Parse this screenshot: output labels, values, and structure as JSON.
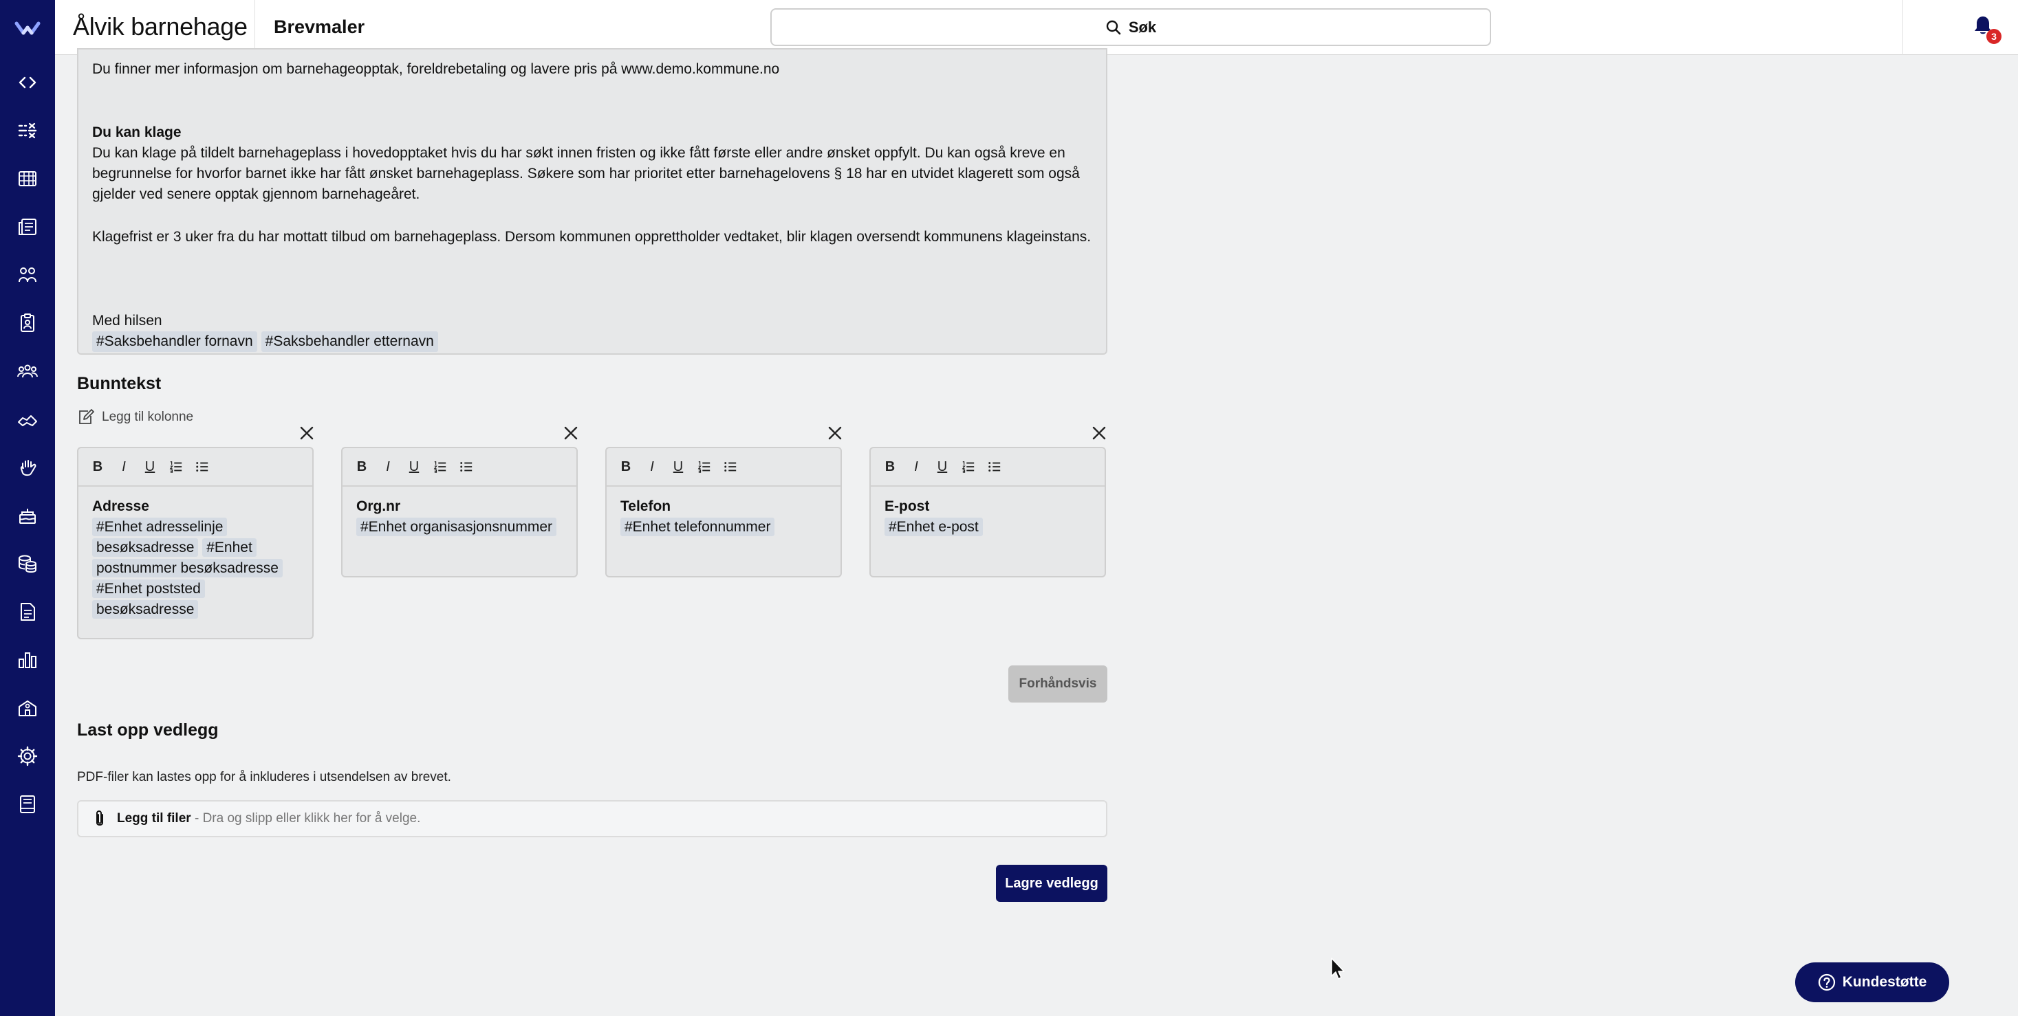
{
  "header": {
    "org_name": "Ålvik barnehage",
    "page_title": "Brevmaler",
    "search_label": "Søk",
    "notification_count": "3"
  },
  "sidebar": {
    "items": [
      {
        "icon": "code-icon"
      },
      {
        "icon": "tasks-icon"
      },
      {
        "icon": "table-icon"
      },
      {
        "icon": "documents-icon"
      },
      {
        "icon": "children-icon"
      },
      {
        "icon": "badge-icon"
      },
      {
        "icon": "group-icon"
      },
      {
        "icon": "handshake-icon"
      },
      {
        "icon": "hand-icon"
      },
      {
        "icon": "cake-icon"
      },
      {
        "icon": "coins-icon"
      },
      {
        "icon": "file-icon"
      },
      {
        "icon": "chart-icon"
      },
      {
        "icon": "school-icon"
      },
      {
        "icon": "settings-icon"
      },
      {
        "icon": "book-icon"
      }
    ]
  },
  "letter": {
    "info_line": "Du finner mer informasjon om barnehageopptak, foreldrebetaling og lavere pris på www.demo.kommune.no",
    "complaint_heading": "Du kan klage",
    "complaint_p1": "Du kan klage på tildelt barnehageplass i hovedopptaket hvis du har søkt innen fristen og ikke fått første eller andre ønsket oppfylt. Du kan også kreve en begrunnelse for hvorfor barnet ikke har fått ønsket barnehageplass. Søkere som har prioritet etter barnehagelovens § 18 har en utvidet klagerett som også gjelder ved senere opptak gjennom barnehageåret.",
    "complaint_p2": "Klagefrist er 3 uker fra du har mottatt tilbud om barnehageplass. Dersom kommunen opprettholder vedtaket, blir klagen oversendt kommunens klageinstans.",
    "closing": "Med hilsen",
    "tag_first_name": "#Saksbehandler fornavn",
    "tag_last_name": "#Saksbehandler etternavn"
  },
  "footer_section": {
    "title": "Bunntekst",
    "add_column": "Legg til kolonne",
    "columns": [
      {
        "heading": "Adresse",
        "tags": [
          "#Enhet adresselinje besøksadresse",
          "#Enhet postnummer besøksadresse",
          "#Enhet poststed besøksadresse"
        ]
      },
      {
        "heading": "Org.nr",
        "tags": [
          "#Enhet organisasjonsnummer"
        ]
      },
      {
        "heading": "Telefon",
        "tags": [
          "#Enhet telefonnummer"
        ]
      },
      {
        "heading": "E-post",
        "tags": [
          "#Enhet e-post"
        ]
      }
    ],
    "toolbar": {
      "bold": "B",
      "italic": "I",
      "underline": "U"
    }
  },
  "preview_button": "Forhåndsvis",
  "upload": {
    "title": "Last opp vedlegg",
    "description": "PDF-filer kan lastes opp for å inkluderes i utsendelsen av brevet.",
    "add_files": "Legg til filer",
    "hint": " - Dra og slipp eller klikk her for å velge.",
    "save_button": "Lagre vedlegg"
  },
  "support_button": "Kundestøtte",
  "colors": {
    "sidebar": "#0c1260",
    "primary_button": "#0c1260",
    "badge": "#d92626",
    "tag": "#d5dbe3"
  }
}
